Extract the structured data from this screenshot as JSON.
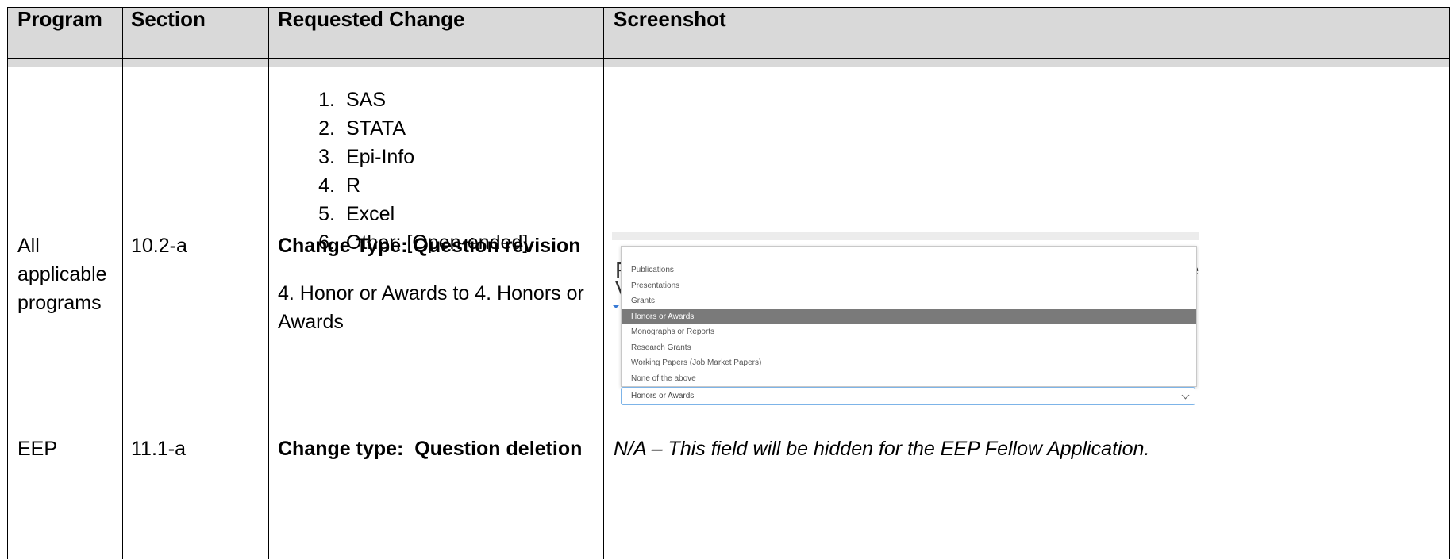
{
  "table": {
    "headers": {
      "program": "Program",
      "section": "Section",
      "requested_change": "Requested Change",
      "screenshot": "Screenshot"
    }
  },
  "row1": {
    "list": [
      {
        "num": "1.",
        "text": "SAS"
      },
      {
        "num": "2.",
        "text": "STATA"
      },
      {
        "num": "3.",
        "text": "Epi-Info"
      },
      {
        "num": "4.",
        "text": "R"
      },
      {
        "num": "5.",
        "text": "Excel"
      },
      {
        "num": "6.",
        "text": "Other: [Open-ended]"
      }
    ]
  },
  "row2": {
    "program_lines": [
      "All",
      "applicable",
      "programs"
    ],
    "section": "10.2-a",
    "change_type": "Change Type: Question revision",
    "change_text_lines": [
      "4. Honor or Awards to 4. Honors or",
      "Awards"
    ],
    "screenshot": {
      "fragment_left_1": "F",
      "fragment_left_2": "V",
      "fragment_right": "e",
      "dropdown_options": [
        "Publications",
        "Presentations",
        "Grants",
        "Honors or Awards",
        "Monographs or Reports",
        "Research Grants",
        "Working Papers (Job Market Papers)",
        "None of the above"
      ],
      "selected_index": 3,
      "select_value": "Honors or Awards"
    }
  },
  "row3": {
    "program": "EEP",
    "section": "11.1-a",
    "change_type": "Change type:  Question deletion",
    "screenshot_note": "N/A – This field will be hidden for the EEP Fellow Application."
  }
}
